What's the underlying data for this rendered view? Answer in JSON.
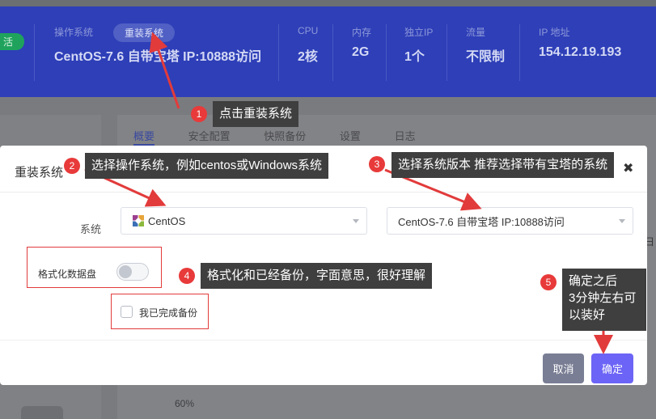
{
  "header": {
    "status_pill": "活",
    "os_label": "操作系统",
    "reinstall_pill": "重装系统",
    "os_value": "CentOS-7.6 自带宝塔 IP:10888访问",
    "stats": [
      {
        "label": "CPU",
        "value": "2核"
      },
      {
        "label": "内存",
        "value": "2G"
      },
      {
        "label": "独立IP",
        "value": "1个"
      },
      {
        "label": "流量",
        "value": "不限制"
      },
      {
        "label": "IP 地址",
        "value": "154.12.19.193"
      }
    ]
  },
  "background": {
    "tabs": [
      "概要",
      "安全配置",
      "快照备份",
      "设置",
      "日志"
    ],
    "axis_tick": "60%",
    "side_letter": "日"
  },
  "modal": {
    "title": "重装系统",
    "close_glyph": "✖",
    "system_label": "系统",
    "os_select_value": "CentOS",
    "version_select_value": "CentOS-7.6 自带宝塔 IP:10888访问",
    "format_label": "格式化数据盘",
    "format_enabled": false,
    "backup_label": "我已完成备份",
    "backup_checked": false,
    "cancel_label": "取消",
    "confirm_label": "确定"
  },
  "annotations": [
    {
      "number": "1",
      "text": "点击重装系统"
    },
    {
      "number": "2",
      "text": "选择操作系统，例如centos或Windows系统"
    },
    {
      "number": "3",
      "text": "选择系统版本 推荐选择带有宝塔的系统"
    },
    {
      "number": "4",
      "text": "格式化和已经备份，字面意思，很好理解"
    },
    {
      "number": "5",
      "text_lines": [
        "确定之后",
        "3分钟左右可",
        "以装好"
      ]
    }
  ],
  "colors": {
    "header_bg": "#2e3fb8",
    "confirm_button": "#6c64f6",
    "cancel_button": "#7a7e94",
    "annotation_red": "#e23b3b",
    "callout_bg": "#3f3f3f",
    "status_green": "#1fa35c"
  }
}
